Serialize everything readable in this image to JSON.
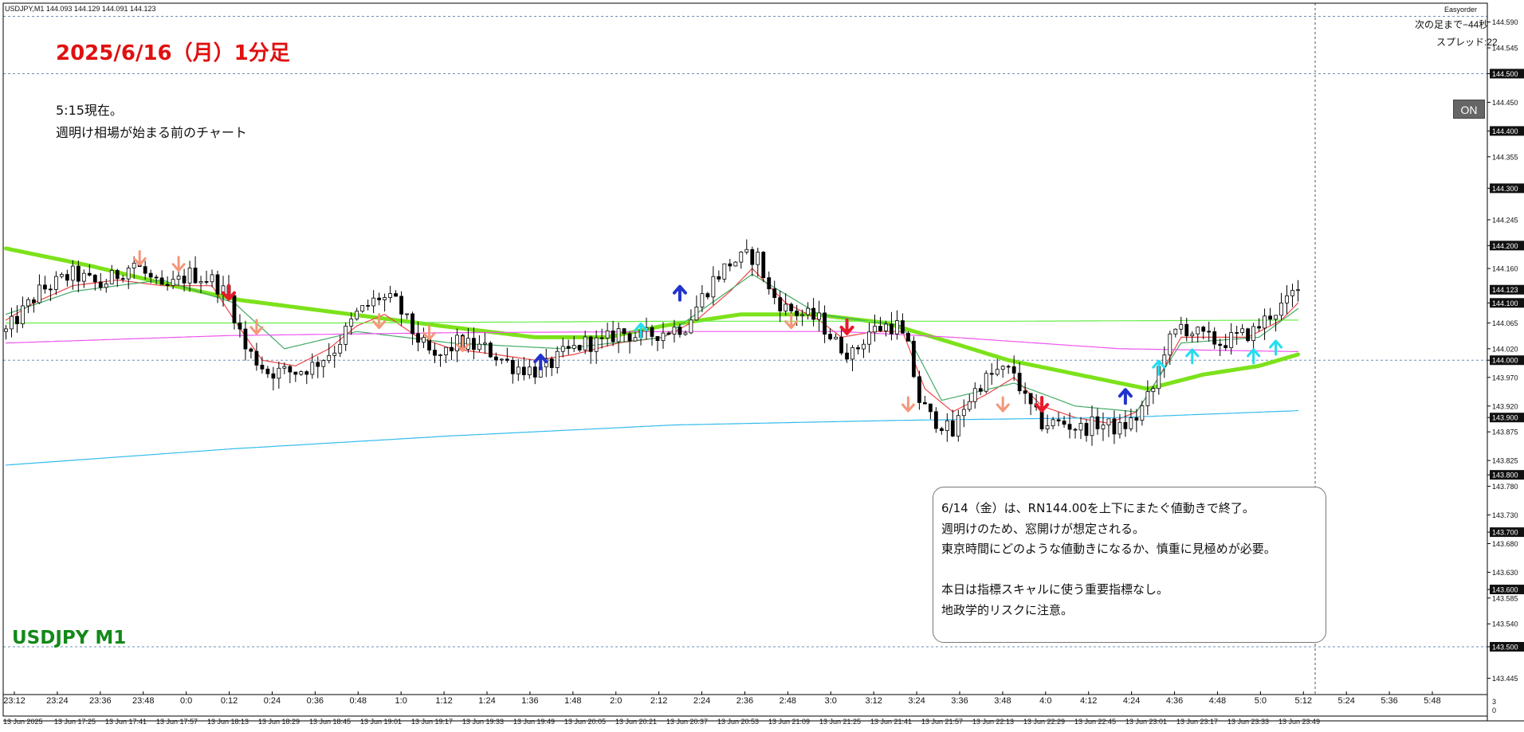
{
  "header": {
    "symbol_info": "USDJPY,M1  144.093 144.129 144.091 144.123",
    "easyorder": "Easyorder",
    "next_bar": "次の足まで−44秒",
    "spread": "スプレッド:22",
    "on_button": "ON"
  },
  "annotations": {
    "title": "2025/6/16（月）1分足",
    "note_line1": "5:15現在。",
    "note_line2": "週明け相場が始まる前のチャート",
    "symbol_label": "USDJPY M1",
    "box_lines": [
      "6/14（金）は、RN144.00を上下にまたぐ値動きで終了。",
      "週明けのため、窓開けが想定される。",
      "東京時間にどのような値動きになるか、慎重に見極めが必要。",
      "",
      "本日は指標スキャルに使う重要指標なし。",
      "地政学的リスクに注意。"
    ]
  },
  "chart_data": {
    "type": "candlestick",
    "symbol": "USDJPY",
    "timeframe": "M1",
    "ylim": [
      143.405,
      144.645
    ],
    "y_ticks": [
      144.59,
      144.545,
      144.5,
      144.45,
      144.4,
      144.355,
      144.3,
      144.245,
      144.2,
      144.16,
      144.1,
      144.065,
      144.02,
      144.0,
      143.97,
      143.92,
      143.9,
      143.875,
      143.825,
      143.8,
      143.78,
      143.73,
      143.7,
      143.68,
      143.63,
      143.6,
      143.585,
      143.54,
      143.5,
      143.445
    ],
    "y_tick_labels": [
      "144.590",
      "144.545",
      "144.500",
      "144.450",
      "144.400",
      "144.355",
      "144.300",
      "144.245",
      "144.200",
      "144.160",
      "144.100",
      "144.065",
      "144.020",
      "144.000",
      "143.970",
      "143.920",
      "143.900",
      "143.875",
      "143.825",
      "143.800",
      "143.780",
      "143.730",
      "143.700",
      "143.680",
      "143.630",
      "143.600",
      "143.585",
      "143.540",
      "143.500",
      "143.445"
    ],
    "highlight_ticks": [
      "144.600",
      "144.500",
      "144.400",
      "144.300",
      "144.200",
      "144.100",
      "144.000",
      "143.900",
      "143.800",
      "143.700",
      "143.600",
      "143.500"
    ],
    "round_levels": [
      144.6,
      144.5,
      144.0,
      143.5
    ],
    "current_price": 144.123,
    "current_price_label": "144.123",
    "time_labels": [
      "23:12",
      "23:24",
      "23:36",
      "23:48",
      "0:0",
      "0:12",
      "0:24",
      "0:36",
      "0:48",
      "1:0",
      "1:12",
      "1:24",
      "1:36",
      "1:48",
      "2:0",
      "2:12",
      "2:24",
      "2:36",
      "2:48",
      "3:0",
      "3:12",
      "3:24",
      "3:36",
      "3:48",
      "4:0",
      "4:12",
      "4:24",
      "4:36",
      "4:48",
      "5:0",
      "5:12",
      "5:24",
      "5:36",
      "5:48"
    ],
    "date_labels": [
      "13 Jun 2025",
      "13 Jun 17:25",
      "13 Jun 17:41",
      "13 Jun 17:57",
      "13 Jun 18:13",
      "13 Jun 18:29",
      "13 Jun 18:45",
      "13 Jun 19:01",
      "13 Jun 19:17",
      "13 Jun 19:33",
      "13 Jun 19:49",
      "13 Jun 20:05",
      "13 Jun 20:21",
      "13 Jun 20:37",
      "13 Jun 20:53",
      "13 Jun 21:09",
      "13 Jun 21:25",
      "13 Jun 21:41",
      "13 Jun 21:57",
      "13 Jun 22:13",
      "13 Jun 22:29",
      "13 Jun 22:45",
      "13 Jun 23:01",
      "13 Jun 23:17",
      "13 Jun 23:33",
      "13 Jun 23:49"
    ],
    "volume_labels": [
      "3",
      "0"
    ],
    "price_path": [
      [
        0,
        144.05
      ],
      [
        6,
        144.12
      ],
      [
        12,
        144.15
      ],
      [
        17,
        144.13
      ],
      [
        23,
        144.17
      ],
      [
        28,
        144.12
      ],
      [
        33,
        144.15
      ],
      [
        37,
        144.14
      ],
      [
        40,
        144.11
      ],
      [
        43,
        144.02
      ],
      [
        47,
        143.98
      ],
      [
        52,
        143.98
      ],
      [
        55,
        143.99
      ],
      [
        59,
        144.02
      ],
      [
        63,
        144.08
      ],
      [
        67,
        144.11
      ],
      [
        70,
        144.1
      ],
      [
        73,
        144.05
      ],
      [
        77,
        144.0
      ],
      [
        81,
        144.03
      ],
      [
        86,
        144.02
      ],
      [
        91,
        143.99
      ],
      [
        96,
        143.98
      ],
      [
        100,
        144.01
      ],
      [
        104,
        144.03
      ],
      [
        107,
        144.03
      ],
      [
        110,
        144.05
      ],
      [
        114,
        144.04
      ],
      [
        118,
        144.05
      ],
      [
        122,
        144.06
      ],
      [
        125,
        144.11
      ],
      [
        127,
        144.14
      ],
      [
        130,
        144.17
      ],
      [
        133,
        144.18
      ],
      [
        135,
        144.18
      ],
      [
        137,
        144.12
      ],
      [
        140,
        144.09
      ],
      [
        143,
        144.08
      ],
      [
        146,
        144.07
      ],
      [
        149,
        144.03
      ],
      [
        152,
        144.01
      ],
      [
        155,
        144.05
      ],
      [
        158,
        144.06
      ],
      [
        160,
        144.06
      ],
      [
        162,
        144.02
      ],
      [
        164,
        143.93
      ],
      [
        166,
        143.9
      ],
      [
        168,
        143.89
      ],
      [
        170,
        143.87
      ],
      [
        172,
        143.92
      ],
      [
        175,
        143.96
      ],
      [
        178,
        143.98
      ],
      [
        181,
        143.98
      ],
      [
        183,
        143.93
      ],
      [
        186,
        143.89
      ],
      [
        190,
        143.89
      ],
      [
        193,
        143.88
      ],
      [
        196,
        143.89
      ],
      [
        200,
        143.88
      ],
      [
        203,
        143.9
      ],
      [
        206,
        143.95
      ],
      [
        208,
        144.02
      ],
      [
        211,
        144.06
      ],
      [
        215,
        144.04
      ],
      [
        218,
        144.03
      ],
      [
        221,
        144.04
      ],
      [
        224,
        144.05
      ],
      [
        227,
        144.08
      ],
      [
        230,
        144.1
      ],
      [
        232,
        144.13
      ]
    ],
    "series": [
      {
        "name": "",
        "color": "#7ce21a",
        "values": [
          [
            0,
            144.195
          ],
          [
            15,
            144.165
          ],
          [
            30,
            144.13
          ],
          [
            42,
            144.105
          ],
          [
            58,
            144.085
          ],
          [
            78,
            144.06
          ],
          [
            95,
            144.04
          ],
          [
            108,
            144.04
          ],
          [
            118,
            144.06
          ],
          [
            132,
            144.08
          ],
          [
            145,
            144.08
          ],
          [
            158,
            144.065
          ],
          [
            170,
            144.03
          ],
          [
            180,
            144.0
          ],
          [
            195,
            143.97
          ],
          [
            205,
            143.95
          ],
          [
            215,
            143.975
          ],
          [
            225,
            143.99
          ],
          [
            232,
            144.01
          ]
        ]
      },
      {
        "name": "",
        "color": "#ee4545",
        "values": [
          [
            0,
            144.07
          ],
          [
            5,
            144.1
          ],
          [
            12,
            144.13
          ],
          [
            20,
            144.14
          ],
          [
            28,
            144.13
          ],
          [
            37,
            144.13
          ],
          [
            41,
            144.07
          ],
          [
            46,
            144.0
          ],
          [
            52,
            143.99
          ],
          [
            58,
            144.02
          ],
          [
            63,
            144.06
          ],
          [
            68,
            144.08
          ],
          [
            74,
            144.04
          ],
          [
            80,
            144.02
          ],
          [
            88,
            144.01
          ],
          [
            95,
            144.0
          ],
          [
            102,
            144.01
          ],
          [
            110,
            144.03
          ],
          [
            118,
            144.04
          ],
          [
            124,
            144.07
          ],
          [
            130,
            144.12
          ],
          [
            134,
            144.16
          ],
          [
            140,
            144.1
          ],
          [
            146,
            144.07
          ],
          [
            150,
            144.04
          ],
          [
            156,
            144.05
          ],
          [
            161,
            144.05
          ],
          [
            165,
            143.95
          ],
          [
            170,
            143.91
          ],
          [
            176,
            143.94
          ],
          [
            181,
            143.97
          ],
          [
            186,
            143.92
          ],
          [
            192,
            143.9
          ],
          [
            198,
            143.89
          ],
          [
            203,
            143.91
          ],
          [
            207,
            143.97
          ],
          [
            211,
            144.04
          ],
          [
            217,
            144.04
          ],
          [
            223,
            144.04
          ],
          [
            229,
            144.07
          ],
          [
            232,
            144.1
          ]
        ]
      },
      {
        "name": "",
        "color": "#44aa66",
        "values": [
          [
            0,
            144.08
          ],
          [
            12,
            144.12
          ],
          [
            28,
            144.14
          ],
          [
            41,
            144.1
          ],
          [
            50,
            144.02
          ],
          [
            63,
            144.05
          ],
          [
            80,
            144.03
          ],
          [
            100,
            144.02
          ],
          [
            118,
            144.04
          ],
          [
            134,
            144.15
          ],
          [
            146,
            144.08
          ],
          [
            161,
            144.06
          ],
          [
            168,
            143.93
          ],
          [
            181,
            143.96
          ],
          [
            192,
            143.92
          ],
          [
            203,
            143.91
          ],
          [
            211,
            144.03
          ],
          [
            225,
            144.04
          ],
          [
            232,
            144.09
          ]
        ]
      },
      {
        "name": "",
        "color": "#66ee44",
        "values": [
          [
            0,
            144.065
          ],
          [
            60,
            144.065
          ],
          [
            120,
            144.068
          ],
          [
            180,
            144.068
          ],
          [
            232,
            144.07
          ]
        ]
      },
      {
        "name": "",
        "color": "#ee55ee",
        "values": [
          [
            0,
            144.03
          ],
          [
            40,
            144.043
          ],
          [
            80,
            144.048
          ],
          [
            120,
            144.05
          ],
          [
            150,
            144.05
          ],
          [
            170,
            144.04
          ],
          [
            200,
            144.02
          ],
          [
            232,
            144.015
          ]
        ]
      },
      {
        "name": "",
        "color": "#33bbee",
        "values": [
          [
            0,
            143.817
          ],
          [
            40,
            143.845
          ],
          [
            80,
            143.868
          ],
          [
            120,
            143.887
          ],
          [
            160,
            143.895
          ],
          [
            200,
            143.9
          ],
          [
            232,
            143.912
          ]
        ]
      }
    ],
    "signals": [
      {
        "i": 24,
        "dir": "down",
        "color": "#f4977a",
        "p": 144.165
      },
      {
        "i": 31,
        "dir": "down",
        "color": "#f4977a",
        "p": 144.155
      },
      {
        "i": 40,
        "dir": "down",
        "color": "#e8192a",
        "p": 144.105
      },
      {
        "i": 45,
        "dir": "down",
        "color": "#f4977a",
        "p": 144.045
      },
      {
        "i": 67,
        "dir": "down",
        "color": "#f4977a",
        "p": 144.055
      },
      {
        "i": 76,
        "dir": "down",
        "color": "#f4977a",
        "p": 144.035
      },
      {
        "i": 82,
        "dir": "down",
        "color": "#f4977a",
        "p": 144.015
      },
      {
        "i": 96,
        "dir": "up",
        "color": "#2233cc",
        "p": 144.01
      },
      {
        "i": 114,
        "dir": "up",
        "color": "#22ddee",
        "p": 144.065
      },
      {
        "i": 121,
        "dir": "up",
        "color": "#2233cc",
        "p": 144.13
      },
      {
        "i": 141,
        "dir": "down",
        "color": "#f4977a",
        "p": 144.055
      },
      {
        "i": 151,
        "dir": "down",
        "color": "#e8192a",
        "p": 144.045
      },
      {
        "i": 162,
        "dir": "down",
        "color": "#f4977a",
        "p": 143.91
      },
      {
        "i": 179,
        "dir": "down",
        "color": "#f4977a",
        "p": 143.91
      },
      {
        "i": 186,
        "dir": "down",
        "color": "#e8192a",
        "p": 143.91
      },
      {
        "i": 201,
        "dir": "up",
        "color": "#2233cc",
        "p": 143.95
      },
      {
        "i": 207,
        "dir": "up",
        "color": "#22ddee",
        "p": 144.0
      },
      {
        "i": 213,
        "dir": "up",
        "color": "#22ddee",
        "p": 144.02
      },
      {
        "i": 224,
        "dir": "up",
        "color": "#22ddee",
        "p": 144.02
      },
      {
        "i": 228,
        "dir": "up",
        "color": "#22ddee",
        "p": 144.035
      }
    ]
  }
}
